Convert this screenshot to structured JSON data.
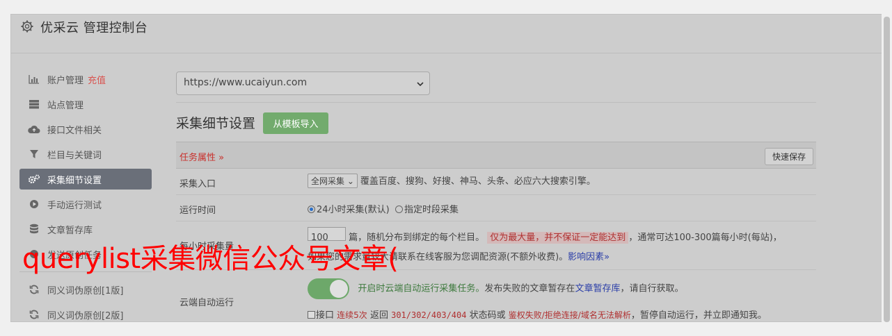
{
  "app": {
    "title": "优采云 管理控制台"
  },
  "sidebar": {
    "items": [
      {
        "label": "账户管理",
        "badge": "充值",
        "icon": "bar-chart-icon"
      },
      {
        "label": "站点管理",
        "icon": "server-icon"
      },
      {
        "label": "接口文件相关",
        "icon": "cloud-upload-icon"
      },
      {
        "label": "栏目与关键词",
        "icon": "filter-icon"
      },
      {
        "label": "采集细节设置",
        "icon": "gears-icon",
        "active": true
      },
      {
        "label": "手动运行测试",
        "icon": "play-circle-icon"
      },
      {
        "label": "文章暂存库",
        "icon": "database-icon"
      },
      {
        "label": "发送原创任务",
        "icon": "send-icon"
      },
      {
        "label": "同义词伪原创[1版]",
        "icon": "refresh-icon"
      },
      {
        "label": "同义词伪原创[2版]",
        "icon": "refresh-icon"
      }
    ]
  },
  "main": {
    "site_select": "https://www.ucaiyun.com",
    "section_title": "采集细节设置",
    "import_button": "从模板导入",
    "task_attr": "任务属性 »",
    "quick_save": "快速保存",
    "rows": {
      "entry": {
        "label": "采集入口",
        "select": "全网采集",
        "desc": "覆盖百度、搜狗、好搜、神马、头条、必应六大搜索引擎。"
      },
      "runtime": {
        "label": "运行时间",
        "opt1": "24小时采集(默认)",
        "opt2": "指定时段采集"
      },
      "quota": {
        "label": "每小时采集量",
        "value": "100",
        "text1": "篇，随机分布到绑定的每个栏目。",
        "warn": "仅为最大量，并不保证一定能达到",
        "text2": "，通常可达100-300篇每小时(每站)，",
        "text3": "如果您的需求量较大请联系在线客服为您调配资源(不额外收费)。",
        "link": "影响因素»"
      },
      "cloud": {
        "label": "云端自动运行",
        "green": "开启时云端自动运行采集任务。",
        "text1": "发布失败的文章暂存在",
        "link": "文章暂存库",
        "text2": "，请自行获取。",
        "cb_label": "接口",
        "red1": "连续5次",
        "t3": "返回",
        "codes": "301/302/403/404",
        "t4": "状态码或",
        "red2": "鉴权失败/拒绝连接/域名无法解析",
        "t5": "，暂停自动运行，并立即通知我。"
      }
    }
  },
  "watermark": "querylist采集微信公众号文章("
}
